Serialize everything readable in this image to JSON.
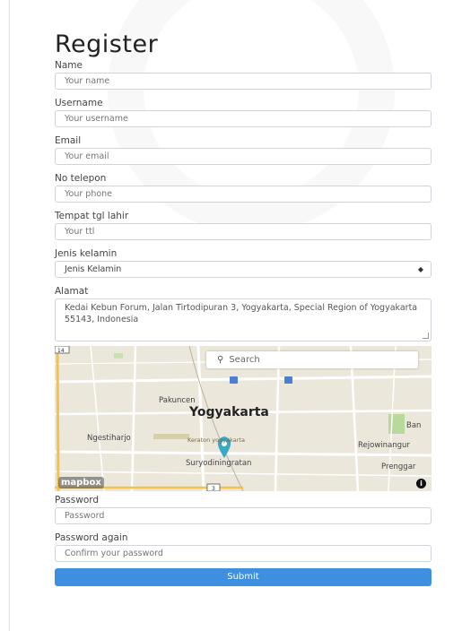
{
  "form": {
    "title": "Register",
    "fields": {
      "name": {
        "label": "Name",
        "placeholder": "Your name"
      },
      "username": {
        "label": "Username",
        "placeholder": "Your username"
      },
      "email": {
        "label": "Email",
        "placeholder": "Your email"
      },
      "phone": {
        "label": "No telepon",
        "placeholder": "Your phone"
      },
      "birth": {
        "label": "Tempat tgl lahir",
        "placeholder": "Your ttl"
      },
      "gender": {
        "label": "Jenis kelamin",
        "selected": "Jenis Kelamin"
      },
      "address": {
        "label": "Alamat",
        "value": "Kedai Kebun Forum, Jalan Tirtodipuran 3, Yogyakarta, Special Region of Yogyakarta 55143, Indonesia"
      },
      "password": {
        "label": "Password",
        "placeholder": "Password"
      },
      "password_again": {
        "label": "Password again",
        "placeholder": "Confirm your password"
      }
    },
    "submit_label": "Submit"
  },
  "map": {
    "search_placeholder": "Search",
    "city": "Yogyakarta",
    "places": {
      "pakuncen": "Pakuncen",
      "ngestiharjo": "Ngestiharjo",
      "keraton": "Keraton yogyakarta",
      "suryodiningratan": "Suryodiningratan",
      "rejowinangun": "Rejowinangur",
      "prenggan": "Prenggar",
      "banguntapan": "Ban"
    },
    "road_shield": "14",
    "road_shield_2": "3",
    "logo": "mapbox",
    "info": "i",
    "colors": {
      "marker": "#3aa8c1",
      "road": "#f3c24b",
      "park": "#b8d99a"
    }
  }
}
